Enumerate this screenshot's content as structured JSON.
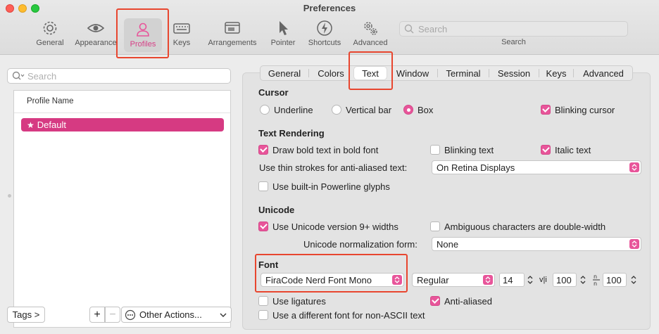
{
  "window": {
    "title": "Preferences"
  },
  "toolbar": {
    "items": [
      {
        "label": "General",
        "icon": "gear-icon"
      },
      {
        "label": "Appearance",
        "icon": "eye-icon"
      },
      {
        "label": "Profiles",
        "icon": "person-icon",
        "selected": true
      },
      {
        "label": "Keys",
        "icon": "keyboard-icon"
      },
      {
        "label": "Arrangements",
        "icon": "windows-icon"
      },
      {
        "label": "Pointer",
        "icon": "pointer-icon"
      },
      {
        "label": "Shortcuts",
        "icon": "lightning-icon"
      },
      {
        "label": "Advanced",
        "icon": "gears-icon"
      }
    ],
    "search_placeholder": "Search",
    "search_caption": "Search"
  },
  "profiles": {
    "search_placeholder": "Search",
    "column_header": "Profile Name",
    "rows": [
      {
        "name": "Default",
        "starred": true,
        "selected": true
      }
    ],
    "tags_button": "Tags >",
    "add_button": "+",
    "remove_button": "−",
    "other_actions": "Other Actions..."
  },
  "tabs": [
    {
      "label": "General"
    },
    {
      "label": "Colors"
    },
    {
      "label": "Text",
      "active": true
    },
    {
      "label": "Window"
    },
    {
      "label": "Terminal"
    },
    {
      "label": "Session"
    },
    {
      "label": "Keys"
    },
    {
      "label": "Advanced"
    }
  ],
  "cursor": {
    "title": "Cursor",
    "options": [
      "Underline",
      "Vertical bar",
      "Box"
    ],
    "selected": "Box",
    "blinking_label": "Blinking cursor",
    "blinking": true
  },
  "text_rendering": {
    "title": "Text Rendering",
    "bold_label": "Draw bold text in bold font",
    "bold": true,
    "blinking_text_label": "Blinking text",
    "blinking_text": false,
    "italic_label": "Italic text",
    "italic": true,
    "thin_strokes_label": "Use thin strokes for anti-aliased text:",
    "thin_strokes_value": "On Retina Displays",
    "powerline_label": "Use built-in Powerline glyphs",
    "powerline": false
  },
  "unicode": {
    "title": "Unicode",
    "v9_label": "Use Unicode version 9+ widths",
    "v9": true,
    "ambiguous_label": "Ambiguous characters are double-width",
    "ambiguous": false,
    "normalization_label": "Unicode normalization form:",
    "normalization_value": "None"
  },
  "font": {
    "title": "Font",
    "family": "FiraCode Nerd Font Mono",
    "style": "Regular",
    "size": "14",
    "vertical_spacing_glyph": "v|i",
    "vertical_spacing": "100",
    "horizontal_spacing_glyph": "n/n",
    "horizontal_spacing": "100",
    "ligatures_label": "Use ligatures",
    "ligatures": false,
    "anti_aliased_label": "Anti-aliased",
    "anti_aliased": true,
    "non_ascii_label": "Use a different font for non-ASCII text",
    "non_ascii": false
  },
  "colors": {
    "accent": "#e8559a",
    "selection": "#d63a82",
    "highlight_box": "#e8462f"
  }
}
